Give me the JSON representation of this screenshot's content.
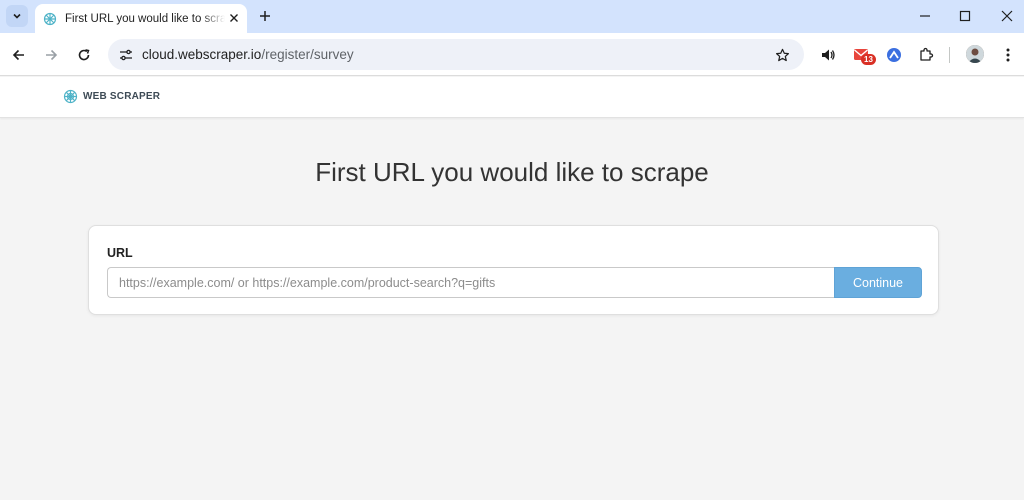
{
  "browser": {
    "tab": {
      "title": "First URL you would like to scrape"
    },
    "address_bar": {
      "host": "cloud.webscraper.io",
      "path": "/register/survey"
    },
    "extensions": {
      "mail_badge": "13"
    }
  },
  "site": {
    "brand": "WEB SCRAPER",
    "heading": "First URL you would like to scrape",
    "form": {
      "label": "URL",
      "placeholder": "https://example.com/ or https://example.com/product-search?q=gifts",
      "value": "",
      "button": "Continue"
    }
  },
  "colors": {
    "tabstrip": "#d3e3fd",
    "page_background": "#f4f4f4",
    "button": "#6aaee0",
    "brand_logo": "#4fb3c8"
  }
}
